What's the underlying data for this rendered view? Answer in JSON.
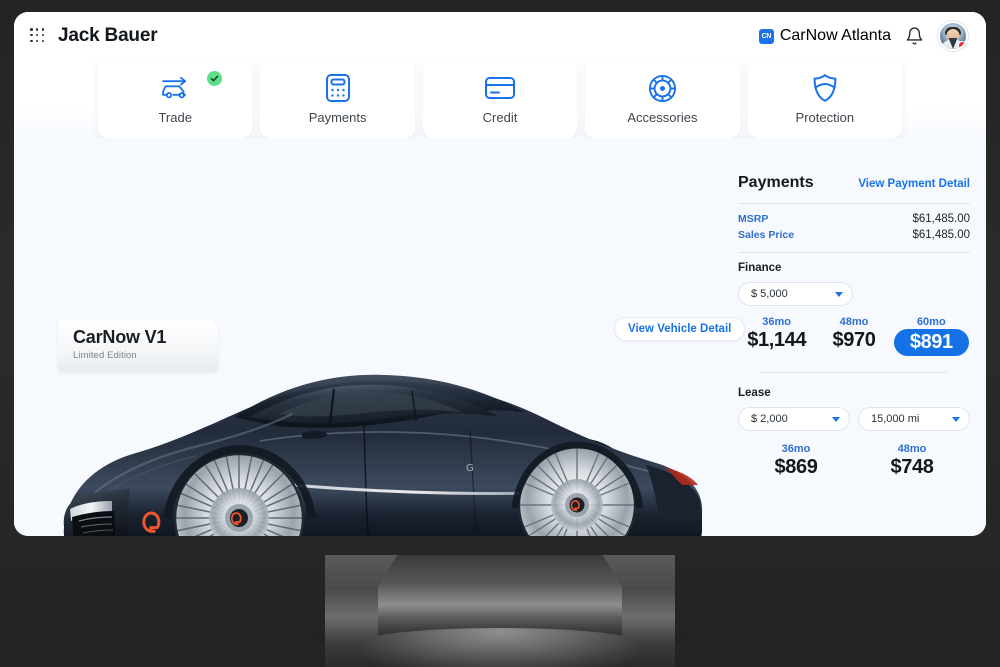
{
  "topbar": {
    "menu_icon": "grid-dots-icon",
    "user_name": "Jack Bauer",
    "dealer_logo_text": "CN",
    "dealer_name": "CarNow Atlanta",
    "bell_icon": "bell-icon",
    "avatar_icon": "user-avatar"
  },
  "navcards": [
    {
      "label": "Trade",
      "icon": "trade-car-arrow-icon",
      "completed": true
    },
    {
      "label": "Payments",
      "icon": "calculator-icon",
      "completed": false
    },
    {
      "label": "Credit",
      "icon": "credit-card-icon",
      "completed": false
    },
    {
      "label": "Accessories",
      "icon": "wheel-icon",
      "completed": false
    },
    {
      "label": "Protection",
      "icon": "shield-icon",
      "completed": false
    }
  ],
  "vehicle": {
    "title": "CarNow V1",
    "subtitle": "Limited Edition",
    "detail_link": "View Vehicle Detail",
    "image_alt": "dark navy luxury concept sedan"
  },
  "payments": {
    "title": "Payments",
    "detail_link": "View Payment Detail",
    "price_rows": [
      {
        "label": "MSRP",
        "value": "$61,485.00"
      },
      {
        "label": "Sales Price",
        "value": "$61,485.00"
      }
    ],
    "finance": {
      "section_label": "Finance",
      "down_payment": "$ 5,000",
      "terms": [
        {
          "term": "36mo",
          "amount": "$1,144",
          "selected": false
        },
        {
          "term": "48mo",
          "amount": "$970",
          "selected": false
        },
        {
          "term": "60mo",
          "amount": "$891",
          "selected": true
        }
      ]
    },
    "lease": {
      "section_label": "Lease",
      "down_payment": "$ 2,000",
      "mileage": "15,000 mi",
      "terms": [
        {
          "term": "36mo",
          "amount": "$869",
          "selected": false
        },
        {
          "term": "48mo",
          "amount": "$748",
          "selected": false
        }
      ]
    }
  },
  "colors": {
    "accent_blue": "#1a73e8",
    "selected_blue": "#1472e6",
    "success_green": "#5ee08a",
    "status_red": "#ef2b2b",
    "panel_bg": "#f6f9fd",
    "text_dark": "#14181c"
  }
}
